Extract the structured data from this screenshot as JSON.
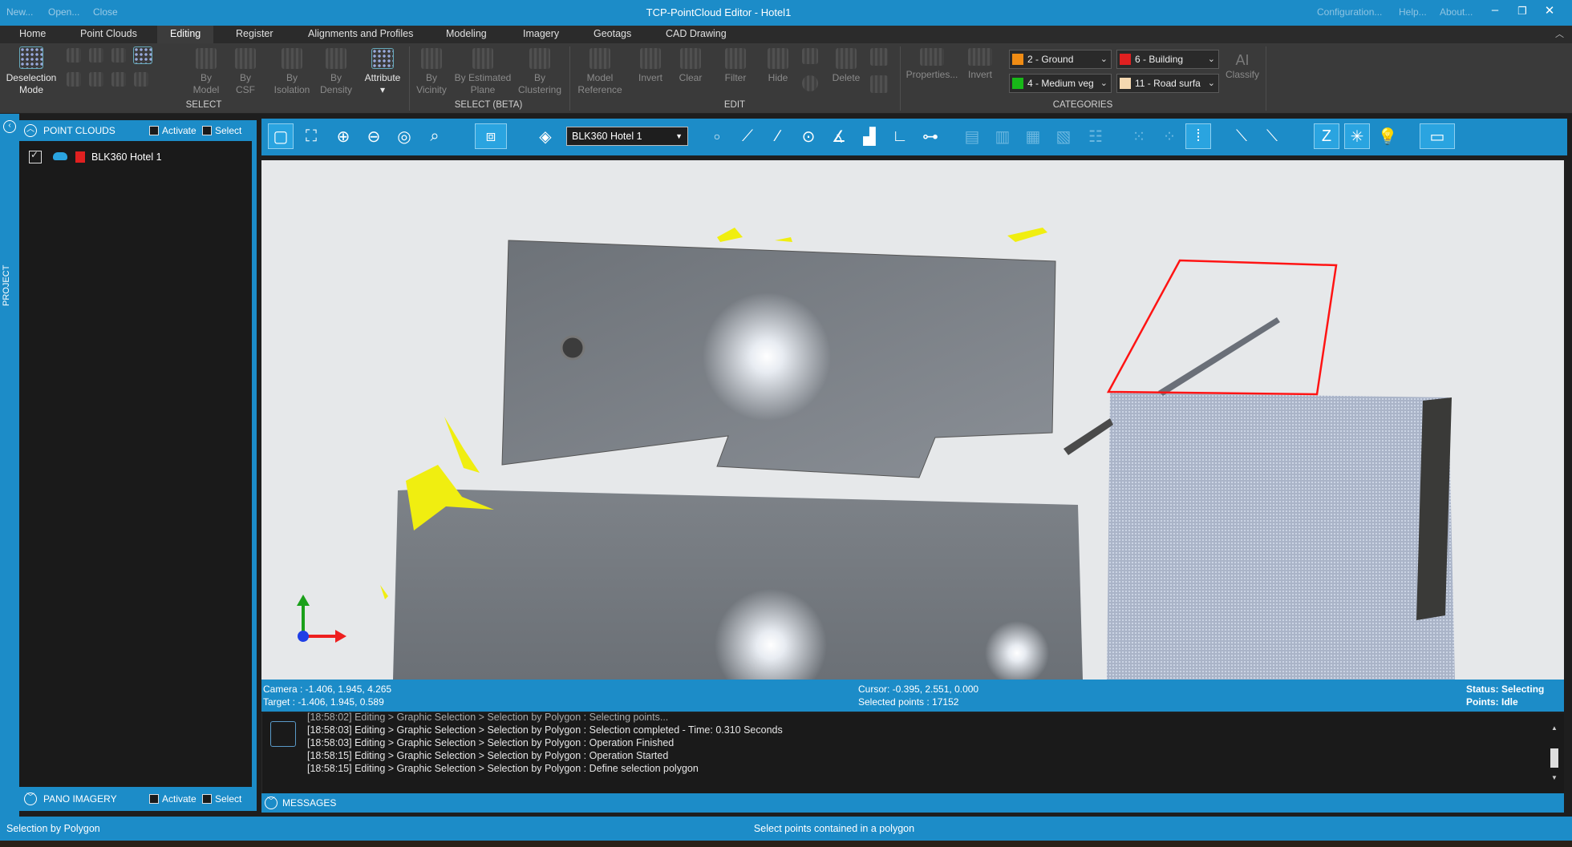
{
  "window": {
    "title": "TCP-PointCloud Editor - Hotel1",
    "quick_access": [
      "New...",
      "Open...",
      "Close"
    ],
    "top_right": [
      "Configuration...",
      "Help...",
      "About..."
    ],
    "controls": [
      "minimize-icon",
      "restore-icon",
      "close-icon"
    ]
  },
  "menu": {
    "tabs": [
      "Home",
      "Point Clouds",
      "Editing",
      "Register",
      "Alignments and Profiles",
      "Modeling",
      "Imagery",
      "Geotags",
      "CAD Drawing"
    ],
    "active": "Editing"
  },
  "ribbon": {
    "deselection_line1": "Deselection",
    "deselection_line2": "Mode",
    "by_model": [
      "By",
      "Model"
    ],
    "by_csf": [
      "By",
      "CSF"
    ],
    "by_isolation": [
      "By",
      "Isolation"
    ],
    "by_density": [
      "By",
      "Density"
    ],
    "attribute": "Attribute",
    "attribute_dd": "▾",
    "by_vicinity": [
      "By",
      "Vicinity"
    ],
    "by_estimated_plane": [
      "By Estimated",
      "Plane"
    ],
    "by_clustering": [
      "By",
      "Clustering"
    ],
    "model_reference": [
      "Model",
      "Reference"
    ],
    "invert": "Invert",
    "clear": "Clear",
    "filter": "Filter",
    "hide": "Hide",
    "delete": "Delete",
    "properties": "Properties...",
    "invert_cat": "Invert",
    "ai": "AI",
    "classify": "Classify",
    "groups": {
      "select": "SELECT",
      "select_beta": "SELECT (BETA)",
      "edit": "EDIT",
      "categories": "CATEGORIES"
    },
    "categories": [
      {
        "label": "2 - Ground",
        "color": "#f08c14"
      },
      {
        "label": "6 - Building",
        "color": "#e02020"
      },
      {
        "label": "4 - Medium veg",
        "color": "#18b818"
      },
      {
        "label": "11 - Road surfa",
        "color": "#f4d8b0"
      }
    ]
  },
  "left_panel": {
    "side_label": "PROJECT",
    "point_clouds_header": "POINT CLOUDS",
    "activate": "Activate",
    "select": "Select",
    "items": [
      {
        "label": "BLK360 Hotel 1",
        "checked": true,
        "color": "#e02020"
      }
    ],
    "pano_header": "PANO IMAGERY",
    "pano_activate": "Activate",
    "pano_select": "Select"
  },
  "view_toolbar": {
    "dataset": "BLK360 Hotel 1"
  },
  "viewport_status": {
    "camera": "Camera : -1.406, 1.945, 4.265",
    "target": "Target : -1.406, 1.945, 0.589",
    "cursor": "Cursor: -0.395, 2.551, 0.000",
    "selected": "Selected points : 17152",
    "status": "Status: Selecting",
    "points": "Points: Idle"
  },
  "messages": {
    "lines": [
      "[18:58:02] Editing > Graphic Selection > Selection by Polygon : Selecting points...",
      "[18:58:03] Editing > Graphic Selection > Selection by Polygon : Selection completed - Time: 0.310 Seconds",
      "[18:58:03] Editing > Graphic Selection > Selection by Polygon : Operation Finished",
      "[18:58:15] Editing > Graphic Selection > Selection by Polygon : Operation Started",
      "[18:58:15] Editing > Graphic Selection > Selection by Polygon : Define selection polygon"
    ],
    "footer": "MESSAGES"
  },
  "status_bar": {
    "left": "Selection by Polygon",
    "center": "Select points contained in a polygon"
  }
}
